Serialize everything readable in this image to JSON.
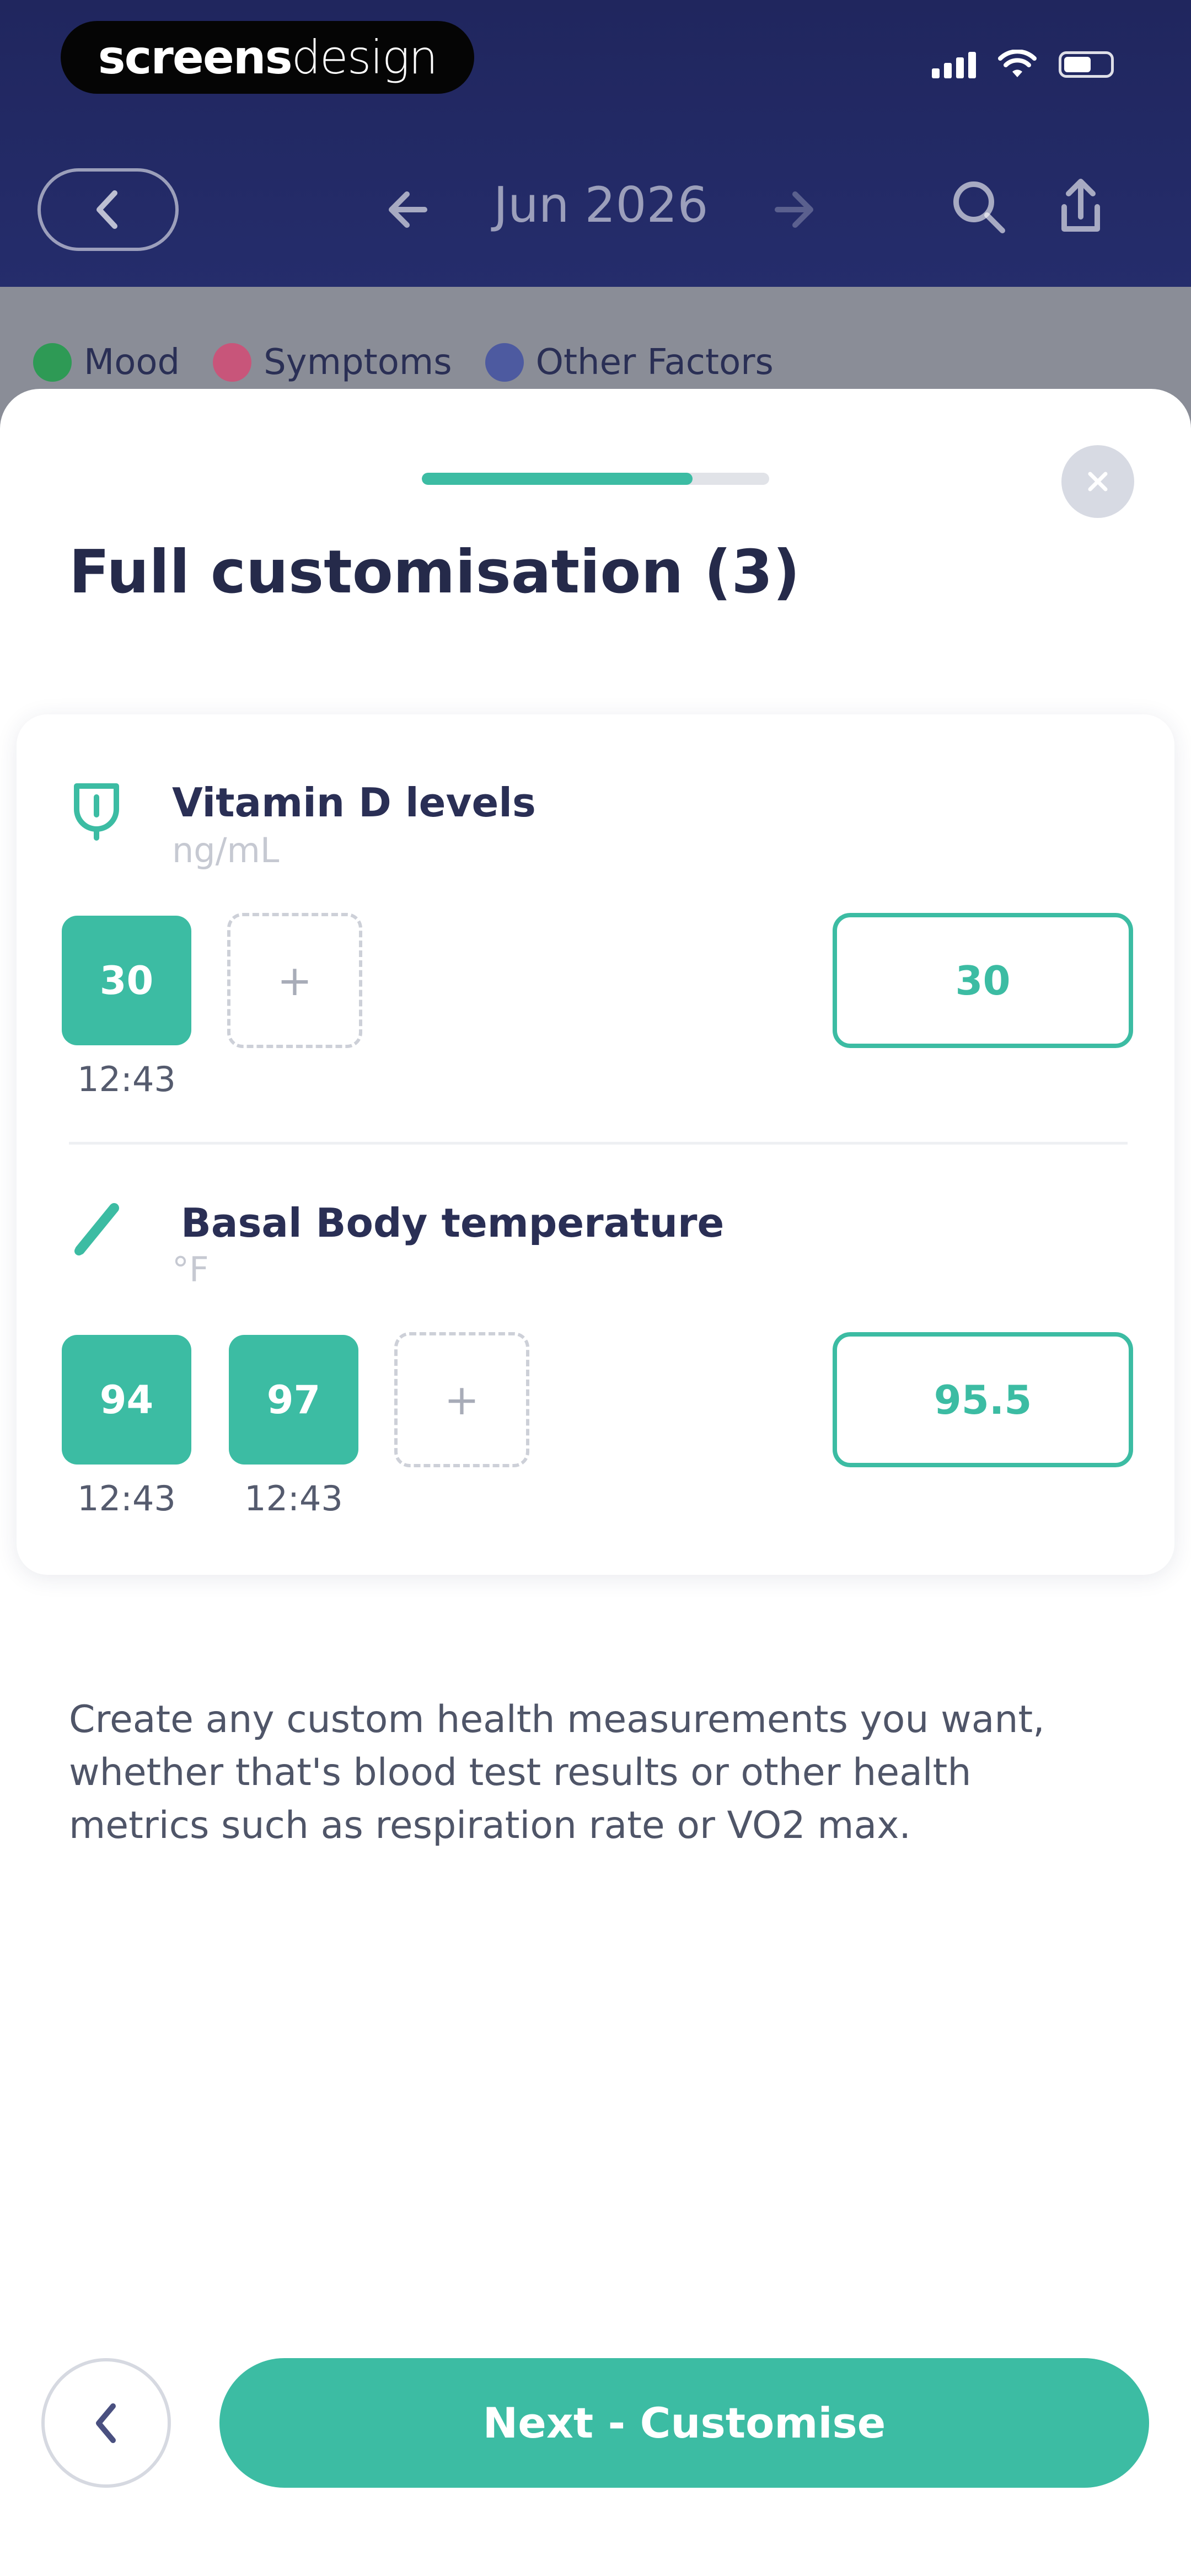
{
  "status_bar": {
    "brand_bold": "screens",
    "brand_light": "design"
  },
  "nav": {
    "title": "Jun 2026"
  },
  "chips": [
    {
      "label": "Mood",
      "color": "#2e9a55"
    },
    {
      "label": "Symptoms",
      "color": "#c8557a"
    },
    {
      "label": "Other Factors",
      "color": "#4d5aa0"
    }
  ],
  "sheet": {
    "title": "Full customisation (3)",
    "progress_fraction": 0.78
  },
  "metrics": [
    {
      "name": "Vitamin D levels",
      "unit": "ng/mL",
      "icon": "syringe-drop-icon",
      "readings": [
        {
          "value": "30",
          "time": "12:43"
        }
      ],
      "add_label": "+",
      "summary_value": "30"
    },
    {
      "name": "Basal Body temperature",
      "unit": "°F",
      "icon": "thermometer-icon",
      "readings": [
        {
          "value": "94",
          "time": "12:43"
        },
        {
          "value": "97",
          "time": "12:43"
        }
      ],
      "add_label": "+",
      "summary_value": "95.5"
    }
  ],
  "description": "Create any custom health measurements you want, whether that's blood test results or other health metrics such as respiration rate or VO2 max.",
  "footer": {
    "next_label": "Next - Customise"
  },
  "colors": {
    "accent": "#3cbca3",
    "navy": "#252a4a",
    "header": "#20265e"
  }
}
